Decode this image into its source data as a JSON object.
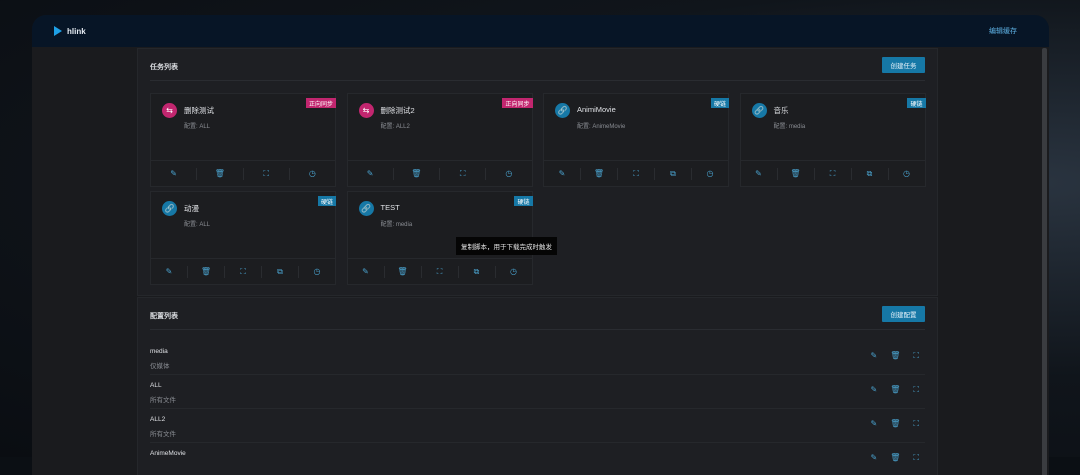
{
  "header": {
    "brand": "hlink",
    "right_link": "编辑缓存"
  },
  "tasks": {
    "title": "任务列表",
    "create_label": "创建任务",
    "items": [
      {
        "name": "删除测试",
        "config": "配置: ALL",
        "tag": "正向同步",
        "type": "sync"
      },
      {
        "name": "删除测试2",
        "config": "配置: ALL2",
        "tag": "正向同步",
        "type": "sync"
      },
      {
        "name": "AnimiMovie",
        "config": "配置: AnimeMovie",
        "tag": "硬链",
        "type": "link"
      },
      {
        "name": "音乐",
        "config": "配置: media",
        "tag": "硬链",
        "type": "link"
      },
      {
        "name": "动漫",
        "config": "配置: ALL",
        "tag": "硬链",
        "type": "link"
      },
      {
        "name": "TEST",
        "config": "配置: media",
        "tag": "硬链",
        "type": "link"
      }
    ],
    "tooltip": "复制脚本，用于下载完成时触发"
  },
  "configs": {
    "title": "配置列表",
    "create_label": "创建配置",
    "items": [
      {
        "name": "media",
        "desc": "仅媒体"
      },
      {
        "name": "ALL",
        "desc": "所有文件"
      },
      {
        "name": "ALL2",
        "desc": "所有文件"
      },
      {
        "name": "AnimeMovie",
        "desc": ""
      }
    ]
  },
  "colors": {
    "sync": "#c2266f",
    "link": "#1678a6",
    "accent": "#1678a6"
  }
}
